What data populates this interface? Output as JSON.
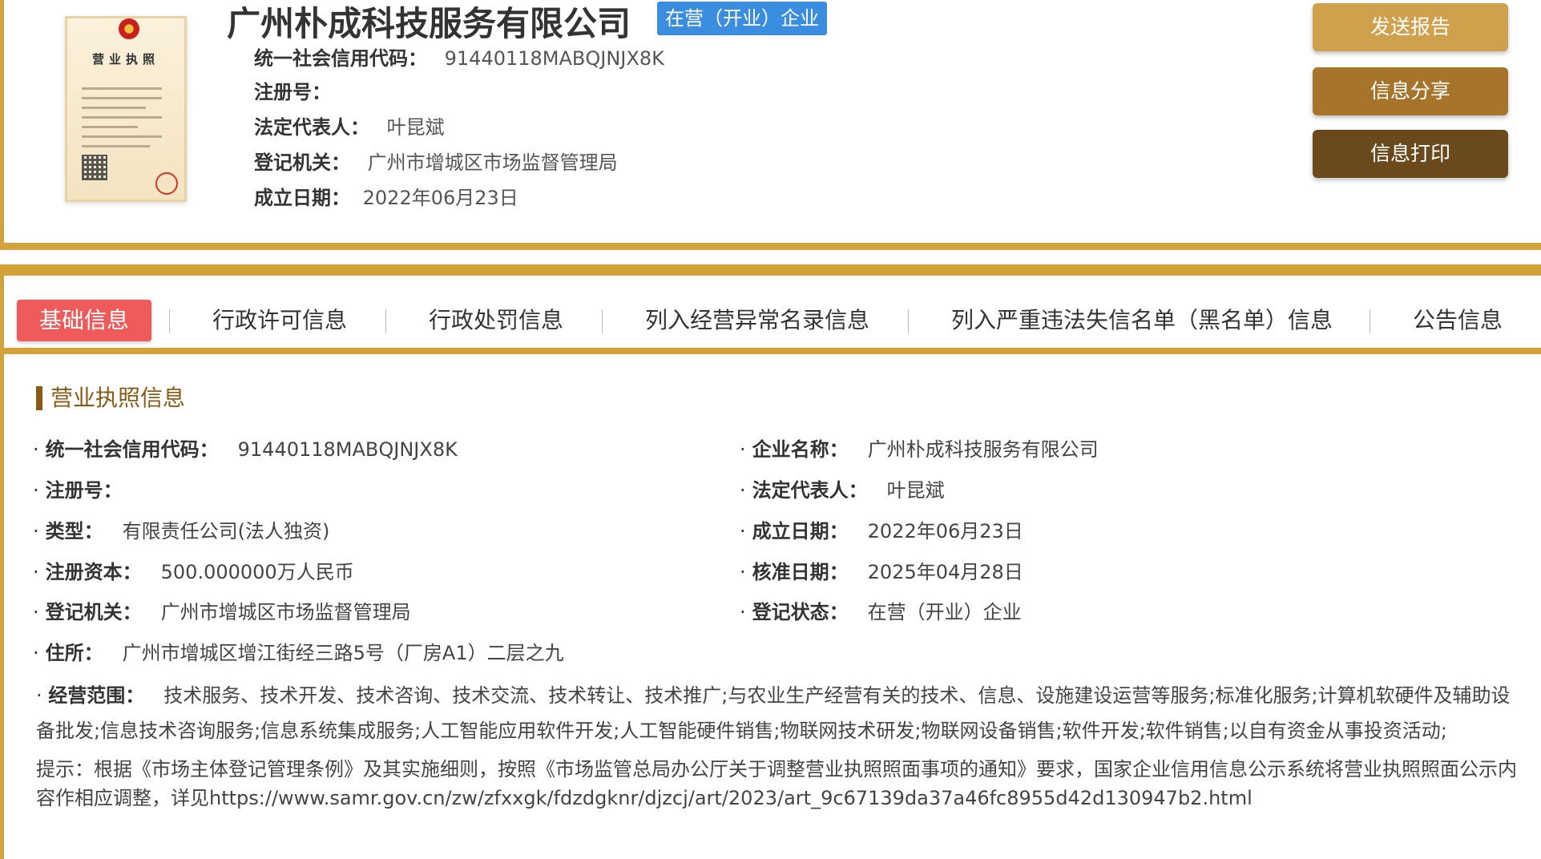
{
  "header": {
    "license_thumb_title": "营业执照",
    "company_name": "广州朴成科技服务有限公司",
    "status_badge": "在营（开业）企业",
    "fields": [
      {
        "label": "统一社会信用代码：",
        "value": "91440118MABQJNJX8K"
      },
      {
        "label": "注册号：",
        "value": ""
      },
      {
        "label": "法定代表人：",
        "value": "叶昆斌"
      },
      {
        "label": "登记机关：",
        "value": "广州市增城区市场监督管理局"
      },
      {
        "label": "成立日期：",
        "value": "2022年06月23日"
      }
    ],
    "buttons": {
      "send_report": "发送报告",
      "share_info": "信息分享",
      "print_info": "信息打印"
    },
    "colors": {
      "accent": "#d4a23b",
      "badge": "#3b8de0",
      "btn_send": "#cfa14d",
      "btn_share": "#a6742a",
      "btn_print": "#6a4a1c"
    }
  },
  "tabs": [
    {
      "label": "基础信息",
      "active": true
    },
    {
      "label": "行政许可信息",
      "active": false
    },
    {
      "label": "行政处罚信息",
      "active": false
    },
    {
      "label": "列入经营异常名录信息",
      "active": false
    },
    {
      "label": "列入严重违法失信名单（黑名单）信息",
      "active": false
    },
    {
      "label": "公告信息",
      "active": false
    }
  ],
  "section": {
    "title": "营业执照信息",
    "left_fields": [
      {
        "label": "统一社会信用代码：",
        "value": "91440118MABQJNJX8K"
      },
      {
        "label": "注册号：",
        "value": ""
      },
      {
        "label": "类型：",
        "value": "有限责任公司(法人独资)"
      },
      {
        "label": "注册资本：",
        "value": "500.000000万人民币"
      },
      {
        "label": "登记机关：",
        "value": "广州市增城区市场监督管理局"
      },
      {
        "label": "住所：",
        "value": "广州市增城区增江街经三路5号（厂房A1）二层之九"
      }
    ],
    "right_fields": [
      {
        "label": "企业名称：",
        "value": "广州朴成科技服务有限公司"
      },
      {
        "label": "法定代表人：",
        "value": "叶昆斌"
      },
      {
        "label": "成立日期：",
        "value": "2022年06月23日"
      },
      {
        "label": "核准日期：",
        "value": "2025年04月28日"
      },
      {
        "label": "登记状态：",
        "value": "在营（开业）企业"
      }
    ],
    "scope": {
      "label": "经营范围：",
      "value": "技术服务、技术开发、技术咨询、技术交流、技术转让、技术推广;与农业生产经营有关的技术、信息、设施建设运营等服务;标准化服务;计算机软硬件及辅助设备批发;信息技术咨询服务;信息系统集成服务;人工智能应用软件开发;人工智能硬件销售;物联网技术研发;物联网设备销售;软件开发;软件销售;以自有资金从事投资活动;"
    },
    "notice": "提示：根据《市场主体登记管理条例》及其实施细则，按照《市场监管总局办公厅关于调整营业执照照面事项的通知》要求，国家企业信用信息公示系统将营业执照照面公示内容作相应调整，详见https://www.samr.gov.cn/zw/zfxxgk/fdzdgknr/djzcj/art/2023/art_9c67139da37a46fc8955d42d130947b2.html"
  }
}
